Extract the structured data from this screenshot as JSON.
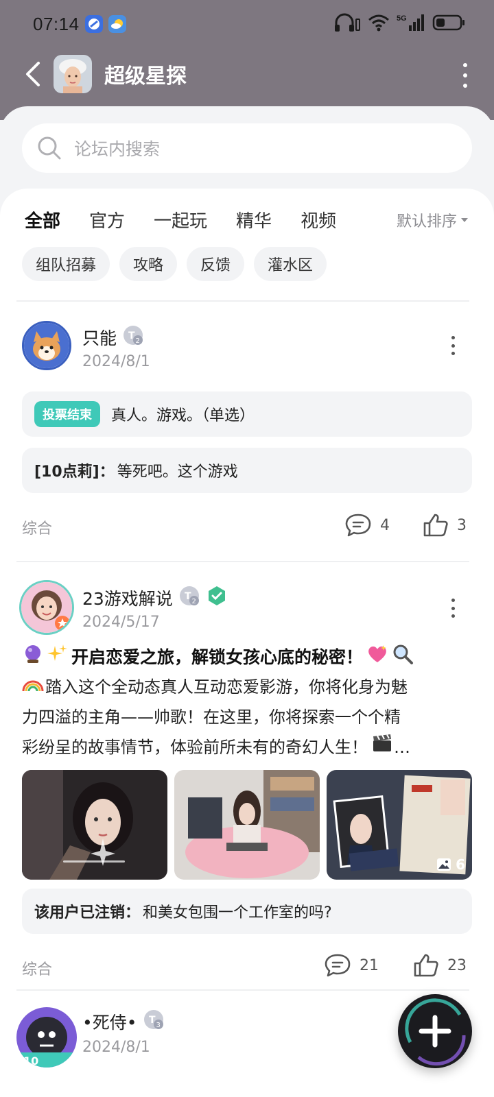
{
  "status": {
    "time": "07:14"
  },
  "header": {
    "title": "超级星探"
  },
  "search": {
    "placeholder": "论坛内搜索"
  },
  "tabs": [
    {
      "label": "全部",
      "active": true
    },
    {
      "label": "官方"
    },
    {
      "label": "一起玩"
    },
    {
      "label": "精华"
    },
    {
      "label": "视频"
    }
  ],
  "sort": {
    "label": "默认排序"
  },
  "chips": [
    "组队招募",
    "攻略",
    "反馈",
    "灌水区"
  ],
  "posts": [
    {
      "author": "只能",
      "badge": "2",
      "date": "2024/8/1",
      "vote_badge": "投票结束",
      "vote_text": "真人。游戏。（单选）",
      "reply_author": "[10点莉]：",
      "reply_text": "等死吧。这个游戏",
      "category": "综合",
      "comments": "4",
      "likes": "3"
    },
    {
      "author": "23游戏解说",
      "badge": "2",
      "date": "2024/5/17",
      "headline": "开启恋爱之旅，解锁女孩心底的秘密！",
      "body_line1": "踏入这个全动态真人互动恋爱影游，你将化身为魅",
      "body_line2": "力四溢的主角——帅歌！在这里，你将探索一个个精",
      "body_line3": "彩纷呈的故事情节，体验前所未有的奇幻人生！",
      "image_count": "6",
      "reply_author": "该用户已注销：",
      "reply_text": "和美女包围一个工作室的吗?",
      "category": "综合",
      "comments": "21",
      "likes": "23"
    },
    {
      "author": "•死侍•",
      "badge": "3",
      "date": "2024/8/1"
    }
  ],
  "colors": {
    "accent": "#3fc9b8",
    "header_bg": "#7e7780"
  }
}
